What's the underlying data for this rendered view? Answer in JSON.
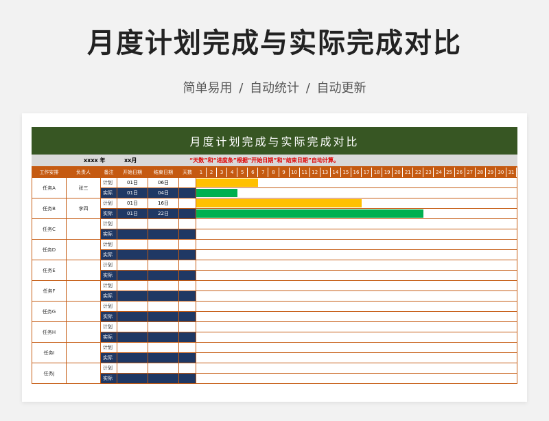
{
  "page": {
    "title": "月度计划完成与实际完成对比",
    "subtitle": "简单易用  /  自动统计  /  自动更新"
  },
  "sheet": {
    "banner": "月度计划完成与实际完成对比",
    "year": "xxxx  年",
    "month": "xx月",
    "note": "“天数”和“进度条”根据“开始日期”和“结束日期”自动计算。",
    "headers": {
      "task": "工作安排",
      "owner": "负责人",
      "remark": "备注",
      "start": "开始日期",
      "end": "结束日期",
      "days": "天数"
    },
    "day_numbers": [
      "1",
      "2",
      "3",
      "4",
      "5",
      "6",
      "7",
      "8",
      "9",
      "10",
      "11",
      "12",
      "13",
      "14",
      "15",
      "16",
      "17",
      "18",
      "19",
      "20",
      "21",
      "22",
      "23",
      "24",
      "25",
      "26",
      "27",
      "28",
      "29",
      "30",
      "31"
    ],
    "plan_label": "计划",
    "actual_label": "实际",
    "colors": {
      "banner": "#375623",
      "header": "#c55a11",
      "actual_row": "#1f3864",
      "plan_bar": "#ffc000",
      "actual_bar": "#00b050"
    },
    "tasks": [
      {
        "name": "任务A",
        "owner": "张三",
        "plan": {
          "start": "01日",
          "end": "06日",
          "from": 1,
          "to": 6
        },
        "actual": {
          "start": "01日",
          "end": "04日",
          "from": 1,
          "to": 4
        }
      },
      {
        "name": "任务B",
        "owner": "李四",
        "plan": {
          "start": "01日",
          "end": "16日",
          "from": 1,
          "to": 16
        },
        "actual": {
          "start": "01日",
          "end": "22日",
          "from": 1,
          "to": 22
        }
      },
      {
        "name": "任务C",
        "owner": "",
        "plan": {
          "start": "",
          "end": ""
        },
        "actual": {
          "start": "",
          "end": ""
        }
      },
      {
        "name": "任务D",
        "owner": "",
        "plan": {
          "start": "",
          "end": ""
        },
        "actual": {
          "start": "",
          "end": ""
        }
      },
      {
        "name": "任务E",
        "owner": "",
        "plan": {
          "start": "",
          "end": ""
        },
        "actual": {
          "start": "",
          "end": ""
        }
      },
      {
        "name": "任务F",
        "owner": "",
        "plan": {
          "start": "",
          "end": ""
        },
        "actual": {
          "start": "",
          "end": ""
        }
      },
      {
        "name": "任务G",
        "owner": "",
        "plan": {
          "start": "",
          "end": ""
        },
        "actual": {
          "start": "",
          "end": ""
        }
      },
      {
        "name": "任务H",
        "owner": "",
        "plan": {
          "start": "",
          "end": ""
        },
        "actual": {
          "start": "",
          "end": ""
        }
      },
      {
        "name": "任务I",
        "owner": "",
        "plan": {
          "start": "",
          "end": ""
        },
        "actual": {
          "start": "",
          "end": ""
        }
      },
      {
        "name": "任务J",
        "owner": "",
        "plan": {
          "start": "",
          "end": ""
        },
        "actual": {
          "start": "",
          "end": ""
        }
      }
    ]
  }
}
